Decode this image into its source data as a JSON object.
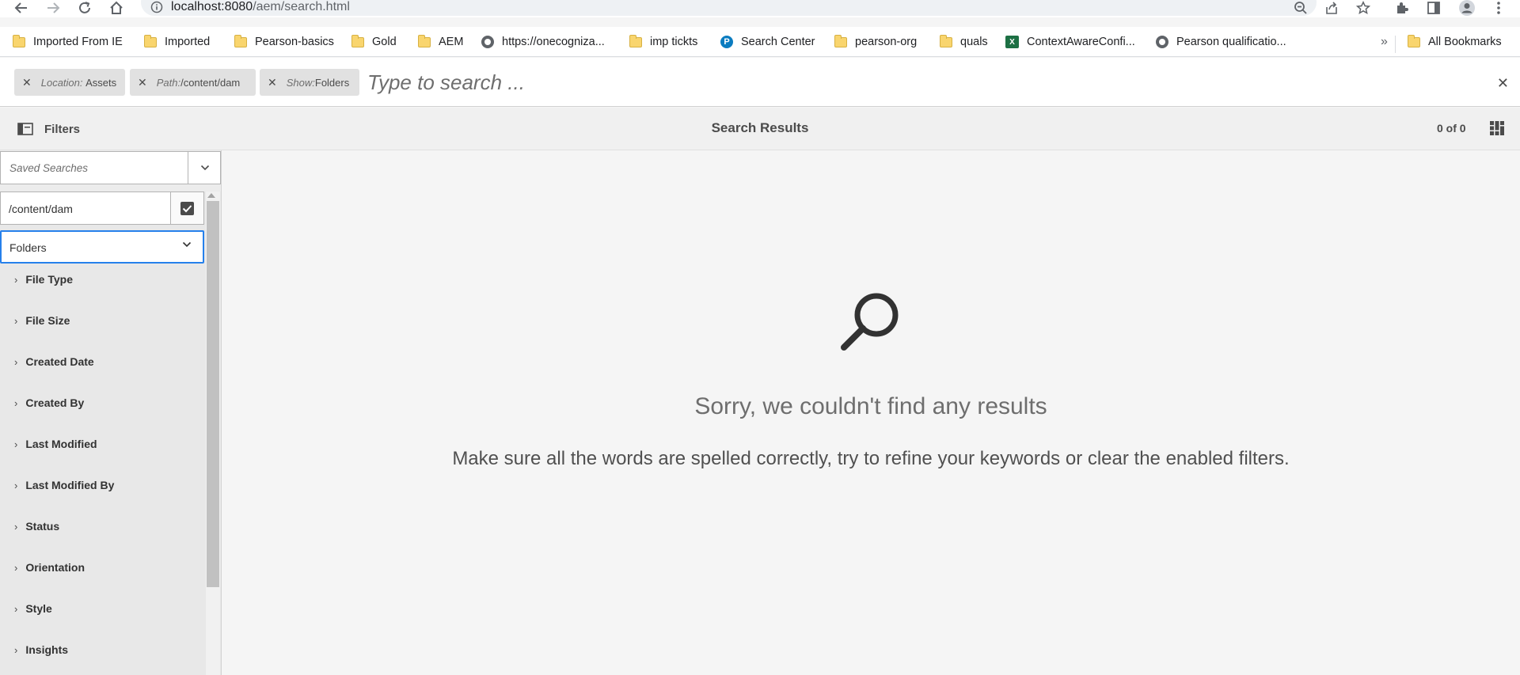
{
  "browser": {
    "url_host": "localhost:8080",
    "url_path": "/aem/search.html",
    "nav_icons": [
      "back-arrow-icon",
      "forward-arrow-icon",
      "reload-icon",
      "home-icon"
    ],
    "toolbar_icons": [
      "zoom-out-icon",
      "share-icon",
      "star-icon",
      "extensions-icon",
      "side-panel-icon",
      "profile-icon",
      "more-vert-icon"
    ]
  },
  "bookmarks": {
    "items": [
      {
        "label": "Imported From IE",
        "icon": "folder"
      },
      {
        "label": "Imported",
        "icon": "folder"
      },
      {
        "label": "Pearson-basics",
        "icon": "folder"
      },
      {
        "label": "Gold",
        "icon": "folder"
      },
      {
        "label": "AEM",
        "icon": "folder"
      },
      {
        "label": "https://onecogniza...",
        "icon": "globe"
      },
      {
        "label": "imp tickts",
        "icon": "folder"
      },
      {
        "label": "Search Center",
        "icon": "pearson"
      },
      {
        "label": "pearson-org",
        "icon": "folder"
      },
      {
        "label": "quals",
        "icon": "folder"
      },
      {
        "label": "ContextAwareConfi...",
        "icon": "excel"
      },
      {
        "label": "Pearson qualificatio...",
        "icon": "globe"
      }
    ],
    "overflow": "»",
    "all_bookmarks": "All Bookmarks"
  },
  "omnisearch": {
    "tags": [
      {
        "key": "Location:",
        "value": "Assets"
      },
      {
        "key": "Path:",
        "value": "/content/dam"
      },
      {
        "key": "Show:",
        "value": "Folders"
      }
    ],
    "placeholder": "Type to search ...",
    "close": "✕"
  },
  "titlebar": {
    "filters_label": "Filters",
    "title": "Search Results",
    "count": "0 of 0"
  },
  "rail": {
    "saved_searches_placeholder": "Saved Searches",
    "path_value": "/content/dam",
    "show_select_value": "Folders",
    "facets": [
      "File Type",
      "File Size",
      "Created Date",
      "Created By",
      "Last Modified",
      "Last Modified By",
      "Status",
      "Orientation",
      "Style",
      "Insights"
    ]
  },
  "empty_state": {
    "title": "Sorry, we couldn't find any results",
    "message": "Make sure all the words are spelled correctly, try to refine your keywords or clear the enabled filters."
  },
  "colors": {
    "accent_focus": "#2680eb",
    "background": "#f5f5f5"
  }
}
